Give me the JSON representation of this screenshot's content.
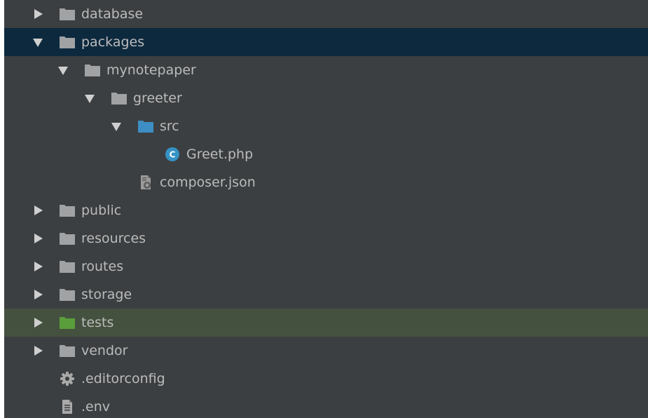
{
  "colors": {
    "background": "#3c3f41",
    "text": "#bbbbbb",
    "selected_row": "#0d293e",
    "highlight_row": "#45513f",
    "folder": "#a0a2a4",
    "source_folder": "#3d8ec4",
    "test_folder": "#5a9e3b",
    "class_icon": "#3592c4"
  },
  "tree": {
    "items": [
      {
        "label": "database",
        "icon": "folder-icon",
        "state": "collapsed"
      },
      {
        "label": "packages",
        "icon": "folder-icon",
        "state": "expanded",
        "selected": true
      },
      {
        "label": "mynotepaper",
        "icon": "folder-icon",
        "state": "expanded"
      },
      {
        "label": "greeter",
        "icon": "folder-icon",
        "state": "expanded"
      },
      {
        "label": "src",
        "icon": "source-folder-icon",
        "state": "expanded"
      },
      {
        "label": "Greet.php",
        "icon": "php-class-icon",
        "class_badge": "C"
      },
      {
        "label": "composer.json",
        "icon": "composer-file-icon"
      },
      {
        "label": "public",
        "icon": "folder-icon",
        "state": "collapsed"
      },
      {
        "label": "resources",
        "icon": "folder-icon",
        "state": "collapsed"
      },
      {
        "label": "routes",
        "icon": "folder-icon",
        "state": "collapsed"
      },
      {
        "label": "storage",
        "icon": "folder-icon",
        "state": "collapsed"
      },
      {
        "label": "tests",
        "icon": "test-folder-icon",
        "state": "collapsed",
        "highlighted": true
      },
      {
        "label": "vendor",
        "icon": "folder-icon",
        "state": "collapsed"
      },
      {
        "label": ".editorconfig",
        "icon": "gear-icon"
      },
      {
        "label": ".env",
        "icon": "text-file-icon"
      }
    ]
  }
}
